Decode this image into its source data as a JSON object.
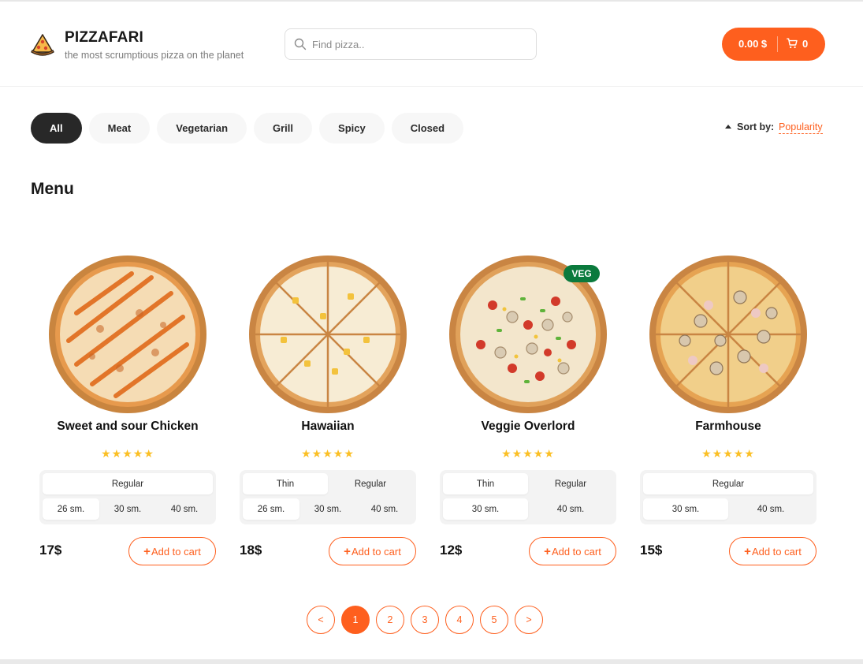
{
  "brand": {
    "title": "PIZZAFARI",
    "subtitle": "the most scrumptious pizza on the planet",
    "logo_icon": "pizza-slice-icon"
  },
  "search": {
    "placeholder": "Find pizza..",
    "value": "",
    "icon": "search-icon"
  },
  "cart": {
    "total": "0.00 $",
    "count": "0",
    "icon": "cart-icon"
  },
  "categories": [
    {
      "label": "All",
      "active": true
    },
    {
      "label": "Meat",
      "active": false
    },
    {
      "label": "Vegetarian",
      "active": false
    },
    {
      "label": "Grill",
      "active": false
    },
    {
      "label": "Spicy",
      "active": false
    },
    {
      "label": "Closed",
      "active": false
    }
  ],
  "sort": {
    "label": "Sort by:",
    "value": "Popularity",
    "direction": "ascending"
  },
  "menu": {
    "title": "Menu"
  },
  "products": [
    {
      "name": "Sweet and sour Chicken",
      "rating": 5,
      "stars": "★★★★★",
      "badge": "",
      "types": [
        {
          "label": "Regular",
          "selected": true
        }
      ],
      "sizes": [
        {
          "label": "26 sm.",
          "selected": true
        },
        {
          "label": "30 sm.",
          "selected": false
        },
        {
          "label": "40 sm.",
          "selected": false
        }
      ],
      "price": "17$",
      "add_label": "Add to cart"
    },
    {
      "name": "Hawaiian",
      "rating": 5,
      "stars": "★★★★★",
      "badge": "",
      "types": [
        {
          "label": "Thin",
          "selected": true
        },
        {
          "label": "Regular",
          "selected": false
        }
      ],
      "sizes": [
        {
          "label": "26 sm.",
          "selected": true
        },
        {
          "label": "30 sm.",
          "selected": false
        },
        {
          "label": "40 sm.",
          "selected": false
        }
      ],
      "price": "18$",
      "add_label": "Add to cart"
    },
    {
      "name": "Veggie Overlord",
      "rating": 5,
      "stars": "★★★★★",
      "badge": "VEG",
      "types": [
        {
          "label": "Thin",
          "selected": true
        },
        {
          "label": "Regular",
          "selected": false
        }
      ],
      "sizes": [
        {
          "label": "30 sm.",
          "selected": true
        },
        {
          "label": "40 sm.",
          "selected": false
        }
      ],
      "price": "12$",
      "add_label": "Add to cart"
    },
    {
      "name": "Farmhouse",
      "rating": 5,
      "stars": "★★★★★",
      "badge": "",
      "types": [
        {
          "label": "Regular",
          "selected": true
        }
      ],
      "sizes": [
        {
          "label": "30 sm.",
          "selected": true
        },
        {
          "label": "40 sm.",
          "selected": false
        }
      ],
      "price": "15$",
      "add_label": "Add to cart"
    }
  ],
  "pagination": {
    "prev": "<",
    "next": ">",
    "pages": [
      "1",
      "2",
      "3",
      "4",
      "5"
    ],
    "current": "1"
  },
  "colors": {
    "accent": "#fe5f1e",
    "dark": "#282828",
    "star": "#fbbf24",
    "veg_badge": "#0b7a3d"
  }
}
